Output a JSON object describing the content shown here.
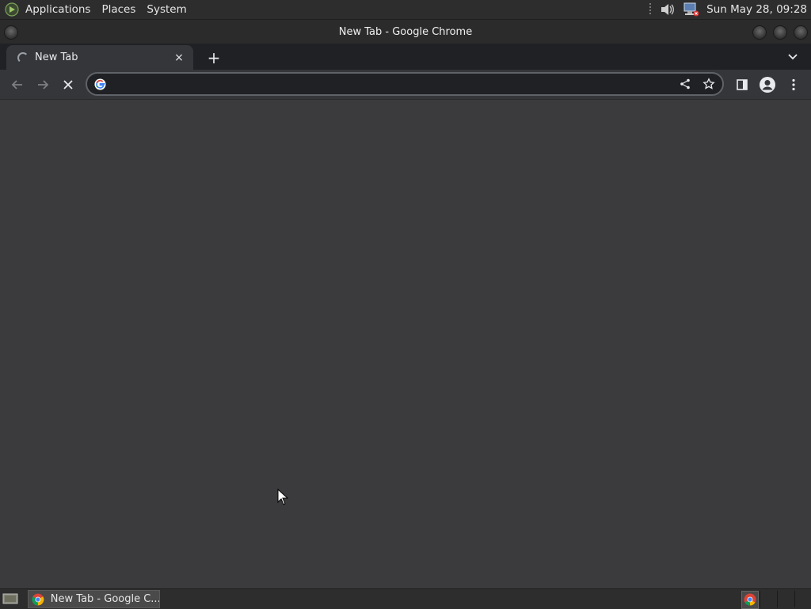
{
  "top_panel": {
    "menus": [
      "Applications",
      "Places",
      "System"
    ],
    "clock": "Sun May 28, 09:28",
    "icons": [
      "distro-menu-icon",
      "volume-icon",
      "network-icon"
    ]
  },
  "window": {
    "title": "New Tab - Google Chrome"
  },
  "browser": {
    "tab": {
      "title": "New Tab",
      "close_glyph": "×"
    },
    "new_tab_glyph": "+",
    "omnibox": {
      "value": "",
      "placeholder": ""
    },
    "colors": {
      "frame": "#202124",
      "toolbar": "#35363a",
      "content": "#3b3b3e"
    }
  },
  "taskbar": {
    "task_label": "New Tab - Google C..."
  }
}
